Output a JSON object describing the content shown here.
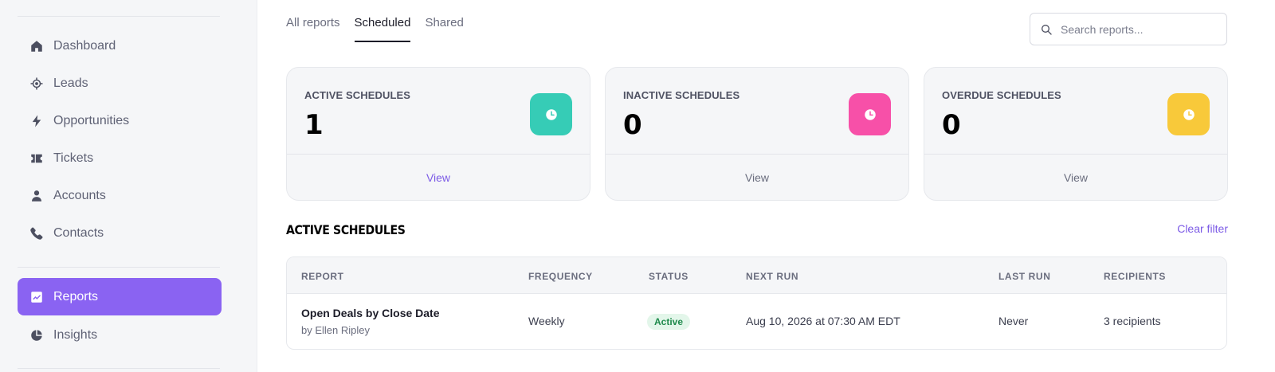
{
  "sidebar": {
    "items": [
      {
        "label": "Dashboard",
        "icon": "home-icon"
      },
      {
        "label": "Leads",
        "icon": "target-icon"
      },
      {
        "label": "Opportunities",
        "icon": "bolt-icon"
      },
      {
        "label": "Tickets",
        "icon": "ticket-icon"
      },
      {
        "label": "Accounts",
        "icon": "person-icon"
      },
      {
        "label": "Contacts",
        "icon": "phone-icon"
      },
      {
        "label": "Reports",
        "icon": "trend-chart-icon",
        "active": true
      },
      {
        "label": "Insights",
        "icon": "pie-chart-icon"
      }
    ]
  },
  "tabs": [
    {
      "label": "All reports"
    },
    {
      "label": "Scheduled",
      "active": true
    },
    {
      "label": "Shared"
    }
  ],
  "search": {
    "placeholder": "Search reports...",
    "value": ""
  },
  "cards": [
    {
      "label": "ACTIVE SCHEDULES",
      "value": "1",
      "action": "View",
      "color": "#36ccb6"
    },
    {
      "label": "INACTIVE SCHEDULES",
      "value": "0",
      "action": "View",
      "color": "#f750a8"
    },
    {
      "label": "OVERDUE SCHEDULES",
      "value": "0",
      "action": "View",
      "color": "#f8c93a"
    }
  ],
  "section": {
    "title": "ACTIVE SCHEDULES",
    "clear_filter": "Clear filter"
  },
  "table": {
    "columns": [
      "REPORT",
      "FREQUENCY",
      "STATUS",
      "NEXT RUN",
      "LAST RUN",
      "RECIPIENTS"
    ],
    "rows": [
      {
        "report": "Open Deals by Close Date",
        "owner": "by Ellen Ripley",
        "frequency": "Weekly",
        "status": "Active",
        "next_run": "Aug 10, 2026 at 07:30 AM EDT",
        "last_run": "Never",
        "recipients": "3 recipients"
      }
    ]
  },
  "colors": {
    "accent": "#8a63f2",
    "link": "#7c5be6",
    "status_active_bg": "#e3f6ea",
    "status_active_text": "#1f8a4c"
  }
}
